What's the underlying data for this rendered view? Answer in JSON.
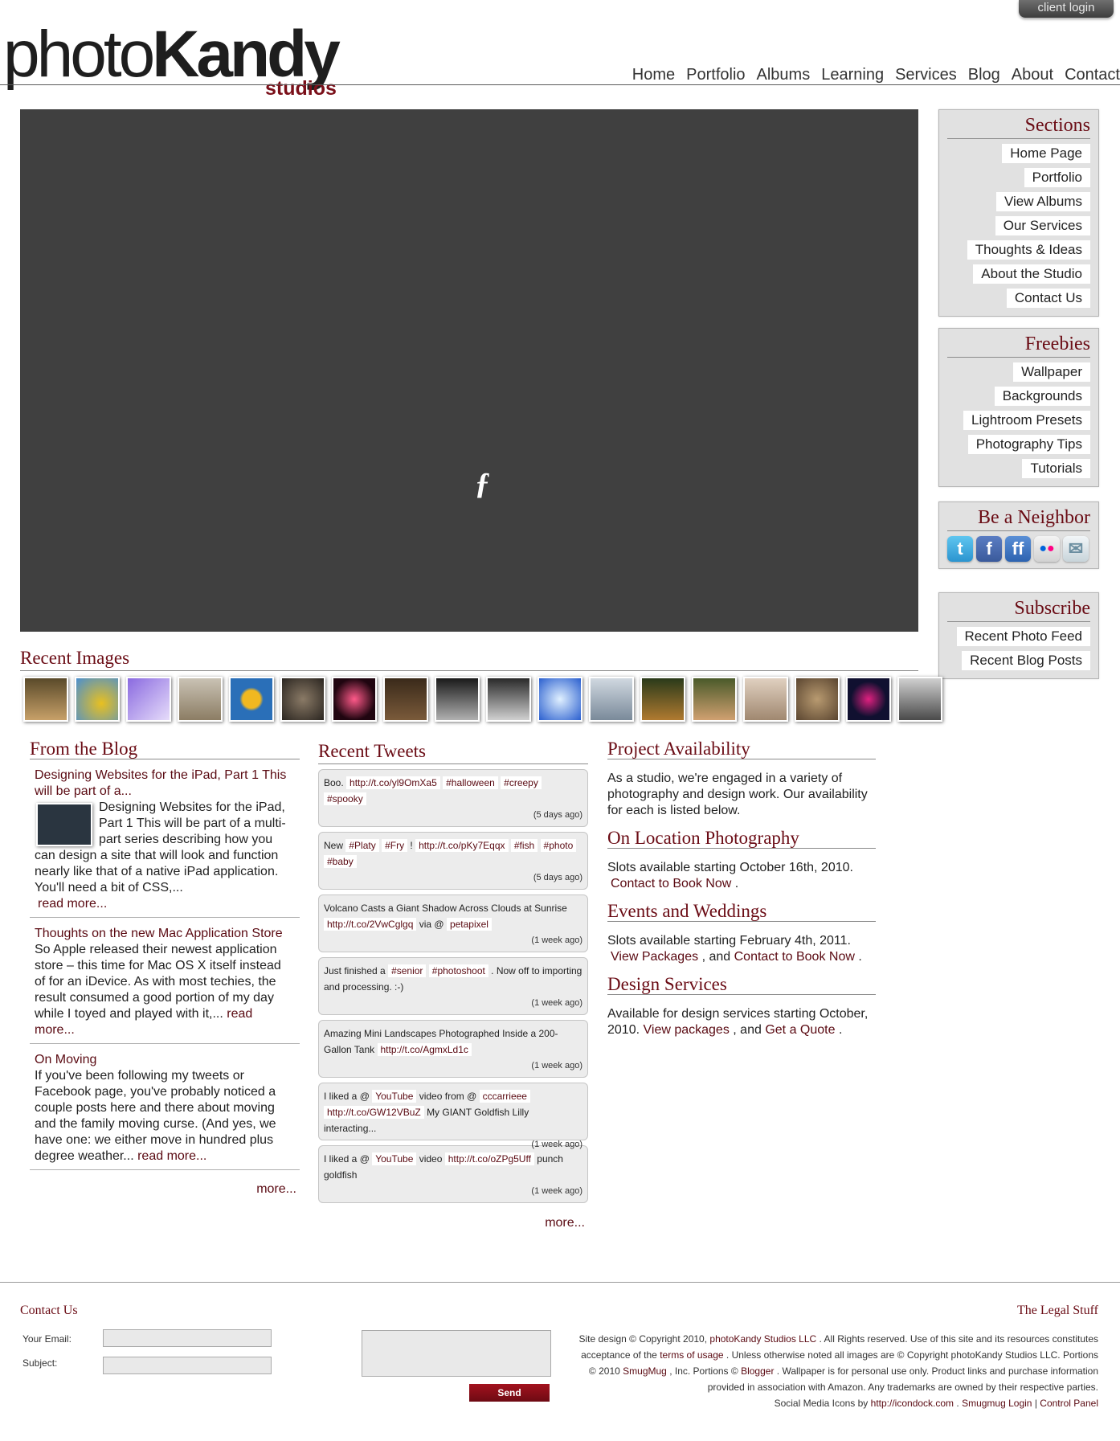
{
  "header": {
    "client_login": "client login",
    "logo": {
      "photo": "photo",
      "kandy": "Kandy",
      "studios": "studios"
    },
    "nav": [
      "Home",
      "Portfolio",
      "Albums",
      "Learning",
      "Services",
      "Blog",
      "About",
      "Contact"
    ]
  },
  "flash": {
    "icon": "flash-plugin-icon"
  },
  "sidebar": {
    "sections": {
      "title": "Sections",
      "items": [
        "Home Page",
        "Portfolio",
        "View Albums",
        "Our Services",
        "Thoughts & Ideas",
        "About the Studio",
        "Contact Us"
      ]
    },
    "freebies": {
      "title": "Freebies",
      "items": [
        "Wallpaper",
        "Backgrounds",
        "Lightroom Presets",
        "Photography Tips",
        "Tutorials"
      ]
    },
    "neighbor": {
      "title": "Be a Neighbor",
      "icons": [
        "twitter-icon",
        "facebook-icon",
        "friendfeed-icon",
        "flickr-icon",
        "email-icon"
      ]
    },
    "subscribe": {
      "title": "Subscribe",
      "items": [
        "Recent Photo Feed",
        "Recent Blog Posts"
      ]
    }
  },
  "recent_images": {
    "title": "Recent Images",
    "count": 18
  },
  "blog": {
    "title": "From the Blog",
    "posts": [
      {
        "title": "Designing Websites for the iPad, Part 1 This will be part of a...",
        "body": "Designing Websites for the iPad, Part 1 This will be part of a multi-part series describing how you can design a site that will look and function nearly like that of a native iPad application. You'll need a bit of CSS,...",
        "more": "read more..."
      },
      {
        "title": "Thoughts on the new Mac Application Store",
        "body": "So Apple released their newest application store – this time for Mac OS X itself instead of for an iDevice. As with most techies, the result consumed a good portion of my day while I toyed and played with it,...",
        "more": "read more..."
      },
      {
        "title": "On Moving",
        "body": "If you've been following my tweets or Facebook page, you've probably noticed a couple posts here and there about moving and the family moving curse. (And yes, we have one: we either move in hundred plus degree weather...",
        "more": "read more..."
      }
    ],
    "more": "more..."
  },
  "tweets": {
    "title": "Recent Tweets",
    "items": [
      {
        "parts": [
          "Boo.",
          "#http://t.co/yl9OmXa5",
          "##halloween",
          "##creepy",
          "##spooky"
        ],
        "ago": "(5 days ago)"
      },
      {
        "parts": [
          "New",
          "##Platy",
          "##Fry",
          "!",
          "#http://t.co/pKy7Eqqx",
          "##fish",
          "##photo",
          "##baby"
        ],
        "ago": "(5 days ago)"
      },
      {
        "parts": [
          "Volcano Casts a Giant Shadow Across Clouds at Sunrise",
          "#http://t.co/2VwCglgq",
          "via @",
          "#petapixel"
        ],
        "ago": "(1 week ago)"
      },
      {
        "parts": [
          "Just finished a",
          "##senior",
          "##photoshoot",
          ". Now off to importing and processing. :-)"
        ],
        "ago": "(1 week ago)"
      },
      {
        "parts": [
          "Amazing Mini Landscapes Photographed Inside a 200-Gallon Tank",
          "#http://t.co/AgmxLd1c"
        ],
        "ago": "(1 week ago)"
      },
      {
        "parts": [
          "I liked a @",
          "#YouTube",
          "video from @",
          "#cccarrieee",
          "#http://t.co/GW12VBuZ",
          "My GIANT Goldfish Lilly interacting..."
        ],
        "ago": "(1 week ago)"
      },
      {
        "parts": [
          "I liked a @",
          "#YouTube",
          "video",
          "#http://t.co/oZPg5Uff",
          "punch goldfish"
        ],
        "ago": "(1 week ago)"
      }
    ],
    "more": "more..."
  },
  "project": {
    "title": "Project Availability",
    "intro": "As a studio, we're engaged in a variety of photography and design work. Our availability for each is listed below.",
    "location": {
      "title": "On Location Photography",
      "text": "Slots available starting October 16th, 2010.",
      "link": "Contact to Book Now",
      "tail": "."
    },
    "events": {
      "title": "Events and Weddings",
      "text": "Slots available starting February 4th, 2011.",
      "link1": "View Packages",
      "mid": ", and",
      "link2": "Contact to Book Now",
      "tail": "."
    },
    "design": {
      "title": "Design Services",
      "text": "Available for design services starting October, 2010.",
      "link1": "View packages",
      "mid": ", and",
      "link2": "Get a Quote",
      "tail": "."
    }
  },
  "footer": {
    "contact_title": "Contact Us",
    "email_label": "Your Email:",
    "subject_label": "Subject:",
    "send": "Send",
    "legal_title": "The Legal Stuff",
    "legal": {
      "l1a": "Site design © Copyright 2010,",
      "l1link": "photoKandy Studios LLC",
      "l1b": ". All Rights reserved. Use of this site and its resources constitutes",
      "l2a": "acceptance of the",
      "l2link": "terms of usage",
      "l2b": ". Unless otherwise noted all images are © Copyright photoKandy Studios LLC. Portions",
      "l3a": "© 2010",
      "l3link1": "SmugMug",
      "l3b": ", Inc. Portions ©",
      "l3link2": "Blogger",
      "l3c": ". Wallpaper is for personal use only. Product links and purchase information",
      "l4": "provided in association with Amazon. Any trademarks are owned by their respective parties.",
      "l5a": "Social Media Icons by",
      "l5link1": "http://icondock.com",
      "l5b": ".",
      "l5link2": "Smugmug Login",
      "l5c": "|",
      "l5link3": "Control Panel"
    }
  },
  "colors": {
    "accent": "#6a0b14",
    "flash_bg": "#404040",
    "sidebar_bg": "#e1e1e1"
  }
}
